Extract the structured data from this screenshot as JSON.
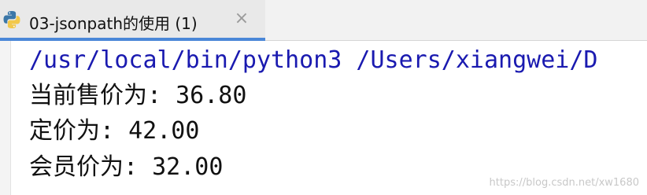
{
  "tab": {
    "title": "03-jsonpath的使用 (1)",
    "close_glyph": "×",
    "icon": "python-icon"
  },
  "console": {
    "command_line": "/usr/local/bin/python3 /Users/xiangwei/D",
    "output_lines": [
      "当前售价为: 36.80",
      "定价为: 42.00",
      "会员价为: 32.00"
    ]
  },
  "watermark": "https://blog.csdn.net/xw1680",
  "colors": {
    "command_text": "#1a1ab0",
    "tab_underline": "#4a87d8"
  }
}
